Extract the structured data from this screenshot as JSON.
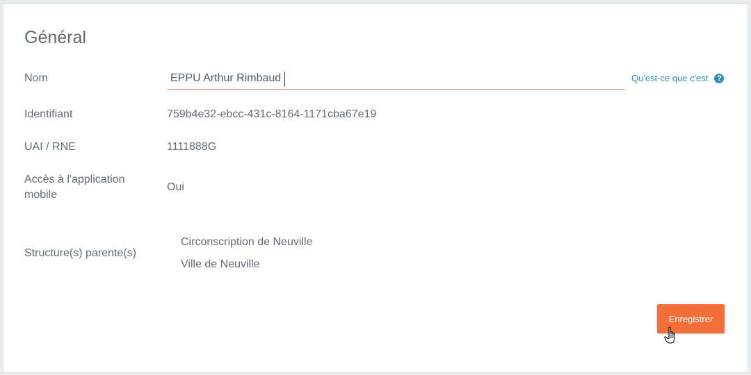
{
  "section": {
    "title": "Général"
  },
  "fields": {
    "nom": {
      "label": "Nom",
      "value": "EPPU Arthur Rimbaud"
    },
    "identifiant": {
      "label": "Identifiant",
      "value": "759b4e32-ebcc-431c-8164-1171cba67e19"
    },
    "uai": {
      "label": "UAI / RNE",
      "value": "1111888G"
    },
    "acces": {
      "label_line1": "Accès à l'application",
      "label_line2": "mobile",
      "value": "Oui"
    },
    "parents": {
      "label": "Structure(s) parente(s)",
      "items": [
        "Circonscription de Neuville",
        "Ville de Neuville"
      ]
    }
  },
  "help": {
    "label": "Qu'est-ce que c'est",
    "icon": "question-circle-icon",
    "color": "#2f8fc0"
  },
  "actions": {
    "save_label": "Enregistrer",
    "accent": "#f36f3a"
  }
}
